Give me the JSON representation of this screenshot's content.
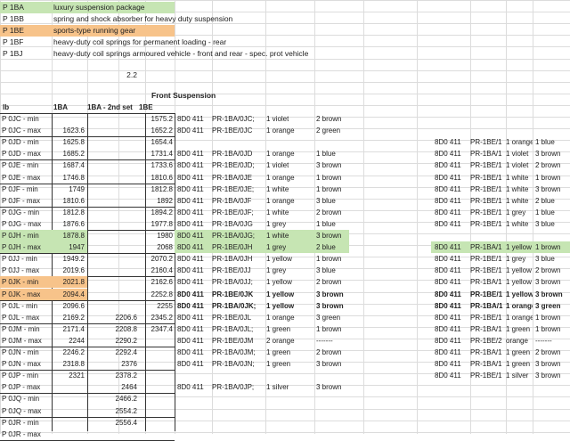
{
  "legend": [
    {
      "code": "P 1BA",
      "desc": "luxury suspension package",
      "bg": "#c6e5b3"
    },
    {
      "code": "P 1BB",
      "desc": "spring and shock absorber for heavy duty suspension",
      "bg": ""
    },
    {
      "code": "P 1BE",
      "desc": "sports-type running gear",
      "bg": "#f7c38a"
    },
    {
      "code": "P 1BF",
      "desc": "heavy-duty coil springs for permanent loading - rear",
      "bg": ""
    },
    {
      "code": "P 1BJ",
      "desc": "heavy-duty coil springs armoured vehicle - front and rear - spec. prot vehicle",
      "bg": ""
    }
  ],
  "version": "2.2",
  "section_title": "Front Suspension",
  "headers": {
    "lb": "lb",
    "c1": "1BA",
    "c2": "1BA - 2nd set",
    "c3": "1BE"
  },
  "rows": [
    {
      "label": "P 0JC - min",
      "v1": "",
      "v2": "",
      "v3": "1575.2",
      "part": "8D0 411",
      "pr": "PR-1BA/0JC;",
      "qty": "1 violet",
      "col": "2 brown",
      "part2": "",
      "pr2": "",
      "c2a": "",
      "c2b": "",
      "style": "",
      "hl": ""
    },
    {
      "label": "P 0JC - max",
      "v1": "1623.6",
      "v2": "",
      "v3": "1652.2",
      "part": "8D0 411",
      "pr": "PR-1BE/0JC",
      "qty": "1 orange",
      "col": "2 green",
      "part2": "",
      "pr2": "",
      "c2a": "",
      "c2b": "",
      "style": "",
      "hl": ""
    },
    {
      "label": "P 0JD - min",
      "v1": "1625.8",
      "v2": "",
      "v3": "1654.4",
      "part": "",
      "pr": "",
      "qty": "",
      "col": "",
      "part2": "8D0 411",
      "pr2": "PR-1BE/1",
      "c2a": "1 orange",
      "c2b": "1 blue",
      "style": "",
      "hl": ""
    },
    {
      "label": "P 0JD - max",
      "v1": "1685.2",
      "v2": "",
      "v3": "1731.4",
      "part": "8D0 411",
      "pr": "PR-1BA/0JD",
      "qty": "1 orange",
      "col": "1 blue",
      "part2": "8D0 411",
      "pr2": "PR-1BA/1",
      "c2a": "1 violet",
      "c2b": "3 brown",
      "style": "",
      "hl": ""
    },
    {
      "label": "P 0JE - min",
      "v1": "1687.4",
      "v2": "",
      "v3": "1733.6",
      "part": "8D0 411",
      "pr": "PR-1BE/0JD;",
      "qty": "1 violet",
      "col": "3 brown",
      "part2": "8D0 411",
      "pr2": "PR-1BE/1",
      "c2a": "1 violet",
      "c2b": "2 brown",
      "style": "",
      "hl": ""
    },
    {
      "label": "P 0JE - max",
      "v1": "1746.8",
      "v2": "",
      "v3": "1810.6",
      "part": "8D0 411",
      "pr": "PR-1BA/0JE",
      "qty": "1 orange",
      "col": "1 brown",
      "part2": "8D0 411",
      "pr2": "PR-1BE/1",
      "c2a": "1 white",
      "c2b": "1 brown",
      "style": "",
      "hl": ""
    },
    {
      "label": "P 0JF - min",
      "v1": "1749",
      "v2": "",
      "v3": "1812.8",
      "part": "8D0 411",
      "pr": "PR-1BE/0JE;",
      "qty": "1 white",
      "col": "1 brown",
      "part2": "8D0 411",
      "pr2": "PR-1BE/1",
      "c2a": "1 white",
      "c2b": "3 brown",
      "style": "",
      "hl": ""
    },
    {
      "label": "P 0JF - max",
      "v1": "1810.6",
      "v2": "",
      "v3": "1892",
      "part": "8D0 411",
      "pr": "PR-1BA/0JF",
      "qty": "1 orange",
      "col": "3 blue",
      "part2": "8D0 411",
      "pr2": "PR-1BE/1",
      "c2a": "1 white",
      "c2b": "2 blue",
      "style": "",
      "hl": ""
    },
    {
      "label": "P 0JG - min",
      "v1": "1812.8",
      "v2": "",
      "v3": "1894.2",
      "part": "8D0 411",
      "pr": "PR-1BE/0JF;",
      "qty": "1 white",
      "col": "2 brown",
      "part2": "8D0 411",
      "pr2": "PR-1BE/1",
      "c2a": "1 grey",
      "c2b": "1 blue",
      "style": "",
      "hl": ""
    },
    {
      "label": "P 0JG - max",
      "v1": "1876.6",
      "v2": "",
      "v3": "1977.8",
      "part": "8D0 411",
      "pr": "PR-1BA/0JG",
      "qty": "1 grey",
      "col": "1 blue",
      "part2": "8D0 411",
      "pr2": "PR-1BE/1",
      "c2a": "1 white",
      "c2b": "3 blue",
      "style": "",
      "hl": ""
    },
    {
      "label": "P 0JH - min",
      "v1": "1878.8",
      "v2": "",
      "v3": "1980",
      "part": "8D0 411",
      "pr": "PR-1BA/0JG;",
      "qty": "1 white",
      "col": "3 brown",
      "part2": "",
      "pr2": "",
      "c2a": "",
      "c2b": "",
      "style": "",
      "hl": "green"
    },
    {
      "label": "P 0JH - max",
      "v1": "1947",
      "v2": "",
      "v3": "2068",
      "part": "8D0 411",
      "pr": "PR-1BE/0JH",
      "qty": "1 grey",
      "col": "2 blue",
      "part2": "8D0 411",
      "pr2": "PR-1BA/1",
      "c2a": "1 yellow",
      "c2b": "1 brown",
      "style": "",
      "hl": "green"
    },
    {
      "label": "P 0JJ - min",
      "v1": "1949.2",
      "v2": "",
      "v3": "2070.2",
      "part": "8D0 411",
      "pr": "PR-1BA/0JH",
      "qty": "1 yellow",
      "col": "1 brown",
      "part2": "8D0 411",
      "pr2": "PR-1BE/1",
      "c2a": "1 grey",
      "c2b": "3 blue",
      "style": "",
      "hl": ""
    },
    {
      "label": "P 0JJ - max",
      "v1": "2019.6",
      "v2": "",
      "v3": "2160.4",
      "part": "8D0 411",
      "pr": "PR-1BE/0JJ",
      "qty": "1 grey",
      "col": "3 blue",
      "part2": "8D0 411",
      "pr2": "PR-1BE/1",
      "c2a": "1 yellow",
      "c2b": "2 brown",
      "style": "",
      "hl": ""
    },
    {
      "label": "P 0JK - min",
      "v1": "2021.8",
      "v2": "",
      "v3": "2162.6",
      "part": "8D0 411",
      "pr": "PR-1BA/0JJ;",
      "qty": "1 yellow",
      "col": "2 brown",
      "part2": "8D0 411",
      "pr2": "PR-1BA/1",
      "c2a": "1 yellow",
      "c2b": "3 brown",
      "style": "",
      "hl": "orange"
    },
    {
      "label": "P 0JK - max",
      "v1": "2094.4",
      "v2": "",
      "v3": "2252.8",
      "part": "8D0 411",
      "pr": "PR-1BE/0JK",
      "qty": "1 yellow",
      "col": "3 brown",
      "part2": "8D0 411",
      "pr2": "PR-1BE/1",
      "c2a": "1 yellow",
      "c2b": "3 brown",
      "style": "bold",
      "hl": "orange"
    },
    {
      "label": "P 0JL - min",
      "v1": "2096.6",
      "v2": "",
      "v3": "2255",
      "part": "8D0 411",
      "pr": "PR-1BA/0JK;",
      "qty": "1 yellow",
      "col": "3 brown",
      "part2": "8D0 411",
      "pr2": "PR-1BA/1",
      "c2a": "1 orange",
      "c2b": "3 green",
      "style": "bold",
      "hl": ""
    },
    {
      "label": "P 0JL - max",
      "v1": "2169.2",
      "v2": "2206.6",
      "v3": "2345.2",
      "part": "8D0 411",
      "pr": "PR-1BE/0JL",
      "qty": "1 orange",
      "col": "3 green",
      "part2": "8D0 411",
      "pr2": "PR-1BE/1",
      "c2a": "1 orange",
      "c2b": "1 brown",
      "style": "",
      "hl": ""
    },
    {
      "label": "P 0JM - min",
      "v1": "2171.4",
      "v2": "2208.8",
      "v3": "2347.4",
      "part": "8D0 411",
      "pr": "PR-1BA/0JL;",
      "qty": "1 green",
      "col": "1 brown",
      "part2": "8D0 411",
      "pr2": "PR-1BA/1",
      "c2a": "1 green",
      "c2b": "1 brown",
      "style": "",
      "hl": ""
    },
    {
      "label": "P 0JM - max",
      "v1": "2244",
      "v2": "2290.2",
      "v3": "",
      "part": "8D0 411",
      "pr": "PR-1BE/0JM",
      "qty": "2 orange",
      "col": "-------",
      "part2": "8D0 411",
      "pr2": "PR-1BE/2",
      "c2a": "orange",
      "c2b": "-------",
      "style": "",
      "hl": ""
    },
    {
      "label": "P 0JN - min",
      "v1": "2246.2",
      "v2": "2292.4",
      "v3": "",
      "part": "8D0 411",
      "pr": "PR-1BA/0JM;",
      "qty": "1 green",
      "col": "2 brown",
      "part2": "8D0 411",
      "pr2": "PR-1BA/1",
      "c2a": "1 green",
      "c2b": "2 brown",
      "style": "",
      "hl": ""
    },
    {
      "label": "P 0JN - max",
      "v1": "2318.8",
      "v2": "2376",
      "v3": "",
      "part": "8D0 411",
      "pr": "PR-1BA/0JN;",
      "qty": "1 green",
      "col": "3 brown",
      "part2": "8D0 411",
      "pr2": "PR-1BA/1",
      "c2a": "1 green",
      "c2b": "3 brown",
      "style": "",
      "hl": ""
    },
    {
      "label": "P 0JP - min",
      "v1": "2321",
      "v2": "2378.2",
      "v3": "",
      "part": "",
      "pr": "",
      "qty": "",
      "col": "",
      "part2": "8D0 411",
      "pr2": "PR-1BE/1",
      "c2a": "1 silver",
      "c2b": "3 brown",
      "style": "",
      "hl": ""
    },
    {
      "label": "P 0JP - max",
      "v1": "",
      "v2": "2464",
      "v3": "",
      "part": "8D0 411",
      "pr": "PR-1BA/0JP;",
      "qty": "1 silver",
      "col": "3 brown",
      "part2": "",
      "pr2": "",
      "c2a": "",
      "c2b": "",
      "style": "",
      "hl": ""
    },
    {
      "label": "P 0JQ - min",
      "v1": "",
      "v2": "2466.2",
      "v3": "",
      "part": "",
      "pr": "",
      "qty": "",
      "col": "",
      "part2": "",
      "pr2": "",
      "c2a": "",
      "c2b": "",
      "style": "",
      "hl": ""
    },
    {
      "label": "P 0JQ - max",
      "v1": "",
      "v2": "2554.2",
      "v3": "",
      "part": "",
      "pr": "",
      "qty": "",
      "col": "",
      "part2": "",
      "pr2": "",
      "c2a": "",
      "c2b": "",
      "style": "",
      "hl": ""
    },
    {
      "label": "P 0JR - min",
      "v1": "",
      "v2": "2556.4",
      "v3": "",
      "part": "",
      "pr": "",
      "qty": "",
      "col": "",
      "part2": "",
      "pr2": "",
      "c2a": "",
      "c2b": "",
      "style": "",
      "hl": ""
    },
    {
      "label": "P 0JR - max",
      "v1": "",
      "v2": "",
      "v3": "",
      "part": "",
      "pr": "",
      "qty": "",
      "col": "",
      "part2": "",
      "pr2": "",
      "c2a": "",
      "c2b": "",
      "style": "",
      "hl": ""
    }
  ],
  "colors": {
    "green_hl": "#c6e5b3",
    "orange_hl": "#f7c38a",
    "grid": "#dcdcdc"
  }
}
